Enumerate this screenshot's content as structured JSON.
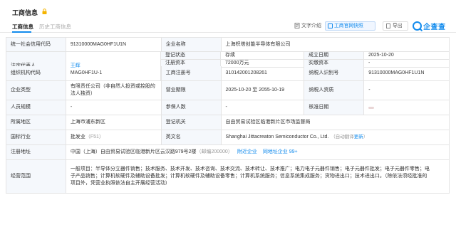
{
  "header": {
    "title": "工商信息",
    "lock_icon": "lock-icon"
  },
  "tabs": [
    {
      "label": "工商信息",
      "active": true
    },
    {
      "label": "历史工商信息",
      "active": false
    }
  ],
  "toolbar": {
    "text_intro_label": "文字介绍",
    "official_label": "工商官网快照",
    "export_label": "导出",
    "logo_text": "企查查"
  },
  "colors": {
    "accent": "#128bed",
    "label_bg": "#f5f8fc",
    "border": "#e4e4e4"
  },
  "rows": {
    "r1": {
      "l1": "统一社会信用代码",
      "v1": "91310000MAG0HF1U1N",
      "l2": "企业名称",
      "v2": "上海枳塔创能半导体有限公司"
    },
    "r2": {
      "l1": "法定代表人",
      "v1": "王辉",
      "l2": "登记状态",
      "v2": "存续",
      "l3": "成立日期",
      "v3": "2025-10-20"
    },
    "r3": {
      "l2": "注册资本",
      "v2": "72000万元",
      "l3": "实缴资本",
      "v3": "-"
    },
    "r4": {
      "l1": "组织机构代码",
      "v1": "MAG0HF1U-1",
      "l2": "工商注册号",
      "v2": "310142001208261",
      "l3": "纳税人识别号",
      "v3": "91310000MAG0HF1U1N"
    },
    "r5": {
      "l1": "企业类型",
      "v1": "有限责任公司（非自然人投资或控股的法人独资）",
      "l2": "营业期限",
      "v2": "2025-10-20 至 2055-10-19",
      "l3": "纳税人资质",
      "v3": "-"
    },
    "r6": {
      "l1": "人员规模",
      "v1": "-",
      "l2": "参保人数",
      "v2": "-",
      "l3": "核准日期",
      "v3": ""
    },
    "r7": {
      "l1": "所属地区",
      "v1": "上海市浦东新区",
      "l2": "登记机关",
      "v2": "自由贸易试验区临港新片区市场监督局"
    },
    "r8": {
      "l1": "国标行业",
      "v1": "批发业",
      "v1_extra": "（F51）",
      "l2": "英文名",
      "v2": "Shanghai Jittacreaton Semiconductor Co., Ltd.",
      "v2_note": "（自动翻译",
      "v2_link": "更新",
      "v2_close": "）"
    },
    "r9": {
      "l1": "注册地址",
      "v1": "中国（上海）自由贸易试验区临港新片区云汉路979号2楼",
      "v1_zip": "（邮编200000）",
      "link1": "附近企业",
      "link2": "同地址企业",
      "count": "99+"
    },
    "r10": {
      "l1": "经营范围",
      "line1": "一般项目：半导体分立器件销售；技术服务、技术开发、技术咨询、技术交流、技术转让、技术推广；电力电子元器件销售；电子元器件批发；电子元器件零售；电",
      "line2": "子产品销售；计算机软硬件及辅助设备批发；计算机软硬件及辅助设备零售；计算机系统服务；信息系统集成服务；货物进出口；技术进出口。（除依法须经批准的",
      "line3": "项目外，凭营业执照依法自主开展经营活动）"
    }
  }
}
